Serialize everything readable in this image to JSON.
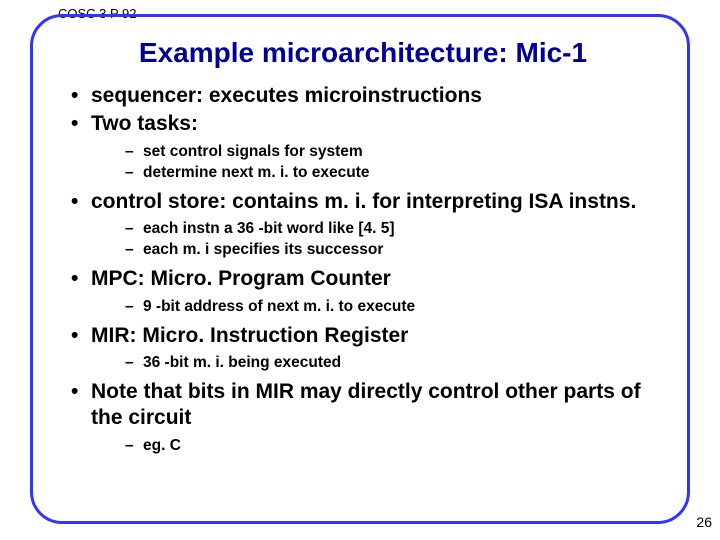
{
  "course": "COSC 3 P 92",
  "title": "Example microarchitecture: Mic-1",
  "bullets": [
    {
      "text": "sequencer: executes microinstructions",
      "sub": []
    },
    {
      "text": "Two tasks:",
      "sub": [
        "set control signals for system",
        "determine next m. i. to execute"
      ]
    },
    {
      "text": "control store: contains m. i. for interpreting ISA instns.",
      "sub": [
        "each instn a 36 -bit word like [4. 5]",
        "each m. i specifies its successor"
      ]
    },
    {
      "text": "MPC: Micro. Program Counter",
      "sub": [
        "9 -bit address of next m. i. to execute"
      ]
    },
    {
      "text": "MIR: Micro. Instruction Register",
      "sub": [
        "36 -bit m. i. being executed"
      ]
    },
    {
      "text": "Note that bits in MIR may directly control other parts of the circuit",
      "sub": [
        "eg. C"
      ]
    }
  ],
  "page_number": "26"
}
